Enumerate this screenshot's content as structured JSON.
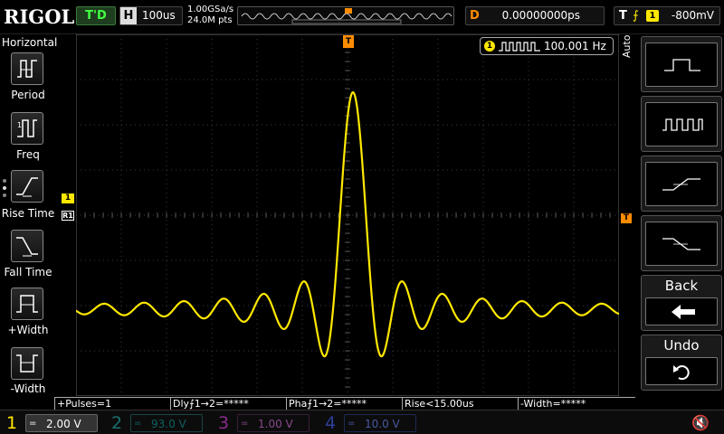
{
  "header": {
    "logo": "RIGOL",
    "trigger_status": "T'D",
    "horizontal": {
      "label": "H",
      "timebase": "100us"
    },
    "sample_rate": "1.00GSa/s",
    "memory_points": "24.0M pts",
    "delay": {
      "label": "D",
      "value": "0.00000000ps"
    },
    "trigger": {
      "label": "T",
      "edge_symbol": "⨍",
      "source": "1",
      "level": "-800mV"
    }
  },
  "left_menu": {
    "title": "Horizontal",
    "items": [
      {
        "label": "Period",
        "icon": "period-icon"
      },
      {
        "label": "Freq",
        "icon": "freq-icon"
      },
      {
        "label": "Rise Time",
        "icon": "rise-time-icon"
      },
      {
        "label": "Fall Time",
        "icon": "fall-time-icon"
      },
      {
        "label": "+Width",
        "icon": "positive-width-icon"
      },
      {
        "label": "-Width",
        "icon": "negative-width-icon"
      }
    ]
  },
  "display": {
    "frequency_counter": {
      "source": "1",
      "value": "100.001 Hz"
    },
    "ch1_marker": "1",
    "ref_marker": "R1",
    "trigger_position_marker": "T",
    "trigger_level_marker": "T",
    "waveform": {
      "type": "sinc",
      "color": "#ffe800"
    }
  },
  "right_menu": {
    "mode_label": "Auto",
    "buttons": [
      {
        "icon": "single-pulse-icon"
      },
      {
        "icon": "pulse-train-icon"
      },
      {
        "icon": "rising-edge-icon"
      },
      {
        "icon": "falling-edge-icon"
      },
      {
        "label": "Back",
        "icon": "back-arrow-icon"
      },
      {
        "label": "Undo",
        "icon": "undo-icon"
      }
    ]
  },
  "measurements": [
    "+Pulses=1",
    "Dly⨍1→2=*****",
    "Pha⨍1→2=*****",
    "Rise<15.00us",
    "-Width=*****"
  ],
  "channels": [
    {
      "number": "1",
      "coupling": "=",
      "scale": "2.00 V",
      "color": "#ffe800"
    },
    {
      "number": "2",
      "coupling": "=",
      "scale": "93.0 V",
      "color": "#1b6f6f"
    },
    {
      "number": "3",
      "coupling": "=",
      "scale": "1.00 V",
      "color": "#8a2b8a"
    },
    {
      "number": "4",
      "coupling": "=",
      "scale": "10.0 V",
      "color": "#2d3e9a"
    }
  ],
  "colors": {
    "ch1": "#ffe800",
    "trigger": "#ff8c00",
    "trigger_status_text": "#41ff41"
  }
}
